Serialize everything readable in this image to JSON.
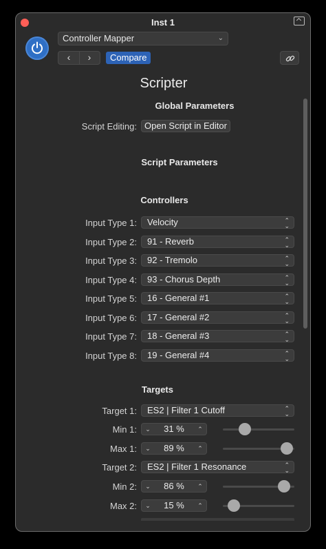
{
  "window": {
    "title": "Inst 1"
  },
  "header": {
    "preset": "Controller Mapper",
    "compare_label": "Compare",
    "plugin_name": "Scripter"
  },
  "global": {
    "heading": "Global Parameters",
    "script_editing_label": "Script Editing:",
    "open_button": "Open Script in Editor"
  },
  "script_params": {
    "heading": "Script Parameters"
  },
  "controllers": {
    "heading": "Controllers",
    "inputs": [
      {
        "label": "Input Type 1:",
        "value": "Velocity"
      },
      {
        "label": "Input Type 2:",
        "value": "91 - Reverb"
      },
      {
        "label": "Input Type 3:",
        "value": "92 - Tremolo"
      },
      {
        "label": "Input Type 4:",
        "value": "93 - Chorus Depth"
      },
      {
        "label": "Input Type 5:",
        "value": "16 - General #1"
      },
      {
        "label": "Input Type 6:",
        "value": "17 - General #2"
      },
      {
        "label": "Input Type 7:",
        "value": "18 - General #3"
      },
      {
        "label": "Input Type 8:",
        "value": "19 - General #4"
      }
    ]
  },
  "targets": {
    "heading": "Targets",
    "target1": {
      "label": "Target 1:",
      "value": "ES2 | Filter 1 Cutoff"
    },
    "min1": {
      "label": "Min 1:",
      "value": "31 %",
      "level": 0.31
    },
    "max1": {
      "label": "Max 1:",
      "value": "89 %",
      "level": 0.89
    },
    "target2": {
      "label": "Target 2:",
      "value": "ES2 | Filter 1 Resonance"
    },
    "min2": {
      "label": "Min 2:",
      "value": "86 %",
      "level": 0.86
    },
    "max2": {
      "label": "Max 2:",
      "value": "15 %",
      "level": 0.15
    }
  },
  "icons": {
    "close": "close-icon",
    "expand": "expand-icon",
    "power": "power-icon",
    "prev": "chevron-left-icon",
    "next": "chevron-right-icon",
    "link": "link-icon",
    "updown": "chevron-updown-icon",
    "stepper_dec": "chevron-down-icon",
    "stepper_inc": "chevron-up-icon"
  },
  "colors": {
    "accent": "#2f6fc5",
    "close": "#ff5f57",
    "background": "#2b2b2b"
  }
}
